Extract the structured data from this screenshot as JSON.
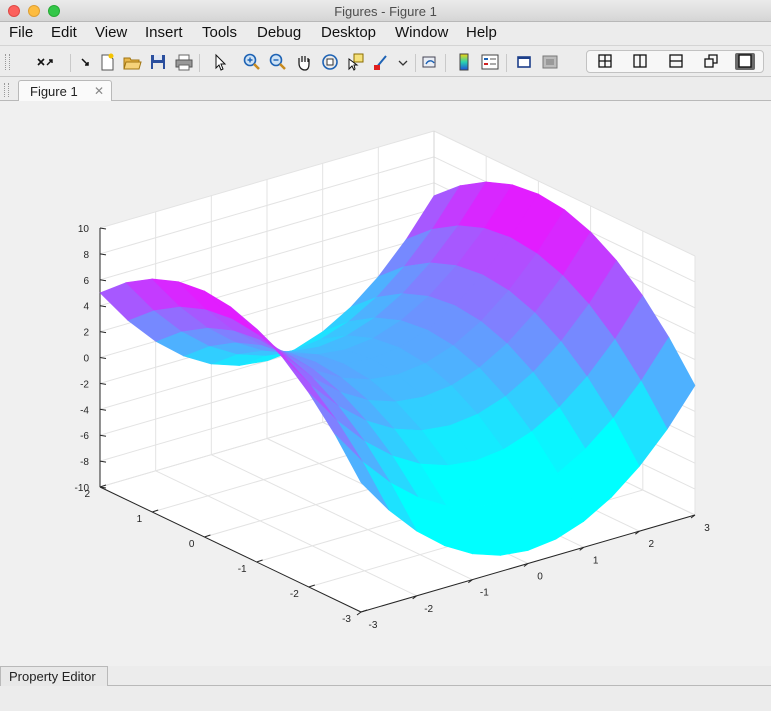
{
  "window": {
    "title": "Figures - Figure 1"
  },
  "menu": [
    "File",
    "Edit",
    "View",
    "Insert",
    "Tools",
    "Debug",
    "Desktop",
    "Window",
    "Help"
  ],
  "toolbar": {
    "icons": [
      "dock-undock-icon",
      "arrow-icon",
      "new-figure-icon",
      "open-icon",
      "save-icon",
      "print-icon",
      "pointer-icon",
      "zoom-in-icon",
      "zoom-out-icon",
      "pan-icon",
      "rotate-3d-icon",
      "data-cursor-icon",
      "brush-icon",
      "link-plot-icon",
      "colorbar-icon",
      "legend-icon",
      "hide-plot-tools-icon",
      "show-plot-tools-icon"
    ],
    "layout_icons": [
      "tile-grid-icon",
      "tile-columns-icon",
      "tile-rows-icon",
      "float-windows-icon",
      "maximize-icon"
    ]
  },
  "tabs": {
    "figure_tab": "Figure 1"
  },
  "chart_data": {
    "type": "surface",
    "title": "",
    "xlabel": "",
    "ylabel": "",
    "zlabel": "",
    "x_ticks": [
      "-3",
      "-2",
      "-1",
      "0",
      "1",
      "2",
      "3"
    ],
    "y_ticks": [
      "-3",
      "-2",
      "-1",
      "0",
      "1",
      "2"
    ],
    "z_ticks": [
      "-10",
      "-8",
      "-6",
      "-4",
      "-2",
      "0",
      "2",
      "4",
      "6",
      "8",
      "10"
    ],
    "xlim": [
      -3,
      3
    ],
    "ylim": [
      -3,
      2
    ],
    "zlim": [
      -10,
      10
    ],
    "grid": true,
    "colormap": [
      "#00ffff",
      "#ff00ff"
    ],
    "description_values": {
      "x": [
        -3,
        -2.5,
        -2,
        -1.5,
        -1,
        -0.5,
        0,
        0.5,
        1,
        1.5,
        2,
        2.5,
        3
      ],
      "y": [
        -3,
        -2.5,
        -2,
        -1.5,
        -1,
        -0.5,
        0,
        0.5,
        1,
        1.5,
        2
      ]
    }
  },
  "bottom": {
    "property_editor": "Property Editor"
  },
  "colors": {
    "surface_low": "#00ffff",
    "surface_high": "#ff00ff",
    "axes_bg": "#ffffff",
    "figure_bg": "#f0f0f0"
  }
}
